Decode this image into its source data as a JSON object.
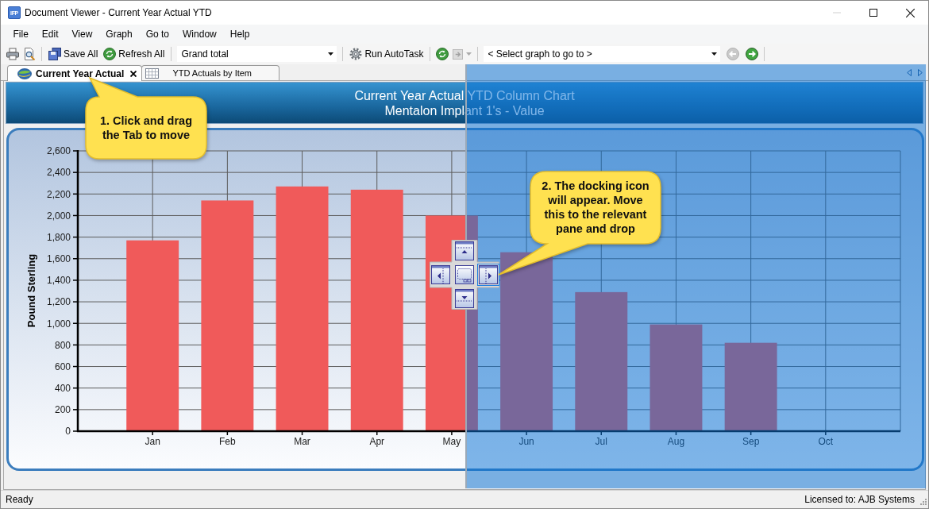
{
  "window": {
    "title": "Document Viewer - Current Year Actual YTD",
    "icon_label": "IFP",
    "controls": [
      {
        "kind": "minimize",
        "disabled": true
      },
      {
        "kind": "maximize",
        "disabled": false
      },
      {
        "kind": "close",
        "disabled": false
      }
    ]
  },
  "menu": [
    "File",
    "Edit",
    "View",
    "Graph",
    "Go to",
    "Window",
    "Help"
  ],
  "toolbar": [
    {
      "kind": "print",
      "disabled": false
    },
    {
      "kind": "preview",
      "disabled": false
    },
    {
      "kind": "separator"
    },
    {
      "kind": "save",
      "label": "Save All",
      "disabled": false
    },
    {
      "kind": "refresh",
      "label": "Refresh All",
      "disabled": false
    },
    {
      "kind": "separator"
    },
    {
      "kind": "combo",
      "value": "Grand total",
      "disabled": false
    },
    {
      "kind": "separator"
    },
    {
      "kind": "autotask",
      "label": "Run AutoTask",
      "disabled": false
    },
    {
      "kind": "separator"
    },
    {
      "kind": "refresh",
      "disabled": false
    },
    {
      "kind": "export",
      "disabled": true
    },
    {
      "kind": "separator"
    },
    {
      "kind": "combo",
      "value": "< Select graph to go to >",
      "disabled": false
    },
    {
      "kind": "back",
      "disabled": true
    },
    {
      "kind": "forward",
      "disabled": false
    },
    {
      "kind": "separator"
    }
  ],
  "tabs": [
    {
      "label": "Current Year Actual",
      "kind": "chart",
      "selected": true
    },
    {
      "label": "YTD Actuals by Item",
      "kind": "table",
      "selected": false
    }
  ],
  "document": {
    "title": "Current Year Actual YTD Column Chart",
    "subtitle": "Mentalon Implant 1's - Value",
    "chart_data": {
      "type": "bar",
      "grid": true,
      "ylabel": "Pound Sterling",
      "categories": [
        "Jan",
        "Feb",
        "Mar",
        "Apr",
        "May",
        "Jun",
        "Jul",
        "Aug",
        "Sep",
        "Oct"
      ],
      "series": [
        {
          "color": "#f05a5a",
          "values": [
            1770,
            2140,
            2270,
            2240,
            2000,
            1660,
            1290,
            990,
            820,
            null
          ]
        }
      ],
      "ylim": [
        0,
        2600
      ],
      "yticks": [
        0,
        200,
        400,
        600,
        800,
        {
          "value": 1000,
          "label": "1,000"
        },
        {
          "value": 1200,
          "label": "1,200"
        },
        {
          "value": 1400,
          "label": "1,400"
        },
        {
          "value": 1600,
          "label": "1,600"
        },
        {
          "value": 1800,
          "label": "1,800"
        },
        {
          "value": 2000,
          "label": "2,000"
        },
        {
          "value": 2200,
          "label": "2,200"
        },
        {
          "value": 2400,
          "label": "2,400"
        },
        {
          "value": 2600,
          "label": "2,600"
        }
      ]
    }
  },
  "dock_guide": {
    "targets": [
      {
        "kind": "top",
        "selected": false
      },
      {
        "kind": "left",
        "selected": false
      },
      {
        "kind": "center",
        "selected": false
      },
      {
        "kind": "right",
        "selected": true
      },
      {
        "kind": "bottom",
        "selected": false
      }
    ]
  },
  "callouts": [
    {
      "text": "1. Click and drag the Tab to move"
    },
    {
      "text": "2. The docking icon will appear. Move this to the relevant pane and drop"
    }
  ],
  "status_bar": {
    "left": "Ready",
    "right": "Licensed to: AJB Systems"
  }
}
